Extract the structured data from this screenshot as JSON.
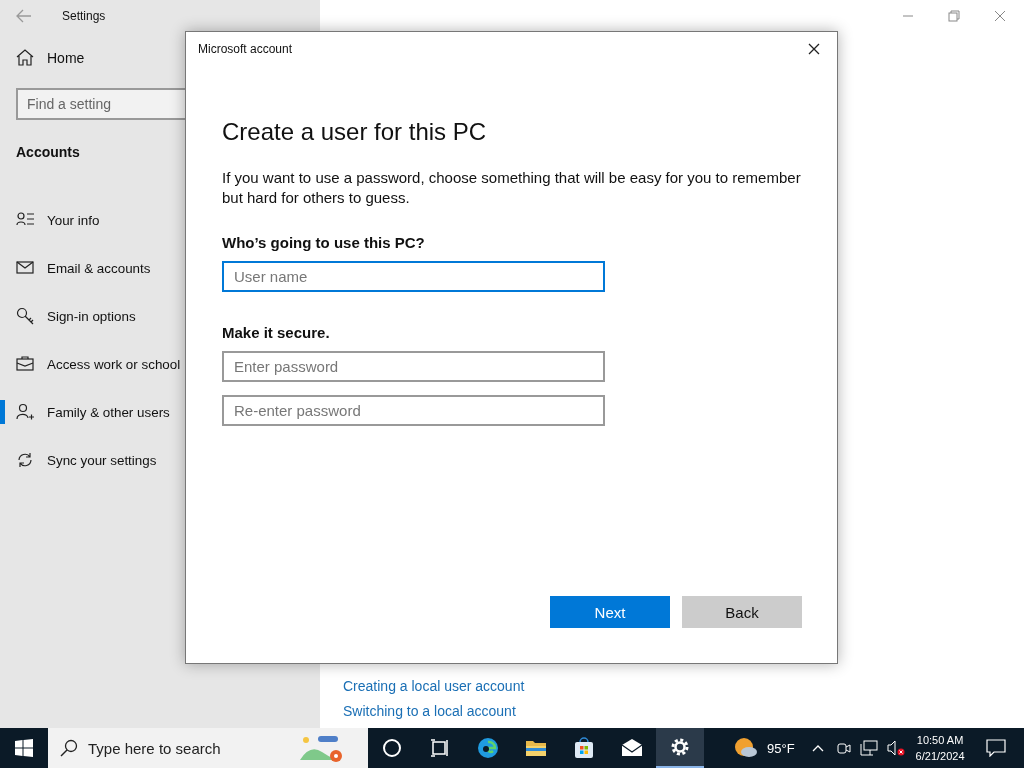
{
  "window": {
    "title": "Settings"
  },
  "sidebar": {
    "home": "Home",
    "search": {
      "placeholder": "Find a setting"
    },
    "section": "Accounts",
    "items": [
      {
        "label": "Your info",
        "kind": "info",
        "selected": false
      },
      {
        "label": "Email & accounts",
        "kind": "mail",
        "selected": false
      },
      {
        "label": "Sign-in options",
        "kind": "key",
        "selected": false
      },
      {
        "label": "Access work or school",
        "kind": "work",
        "selected": false
      },
      {
        "label": "Family & other users",
        "kind": "family",
        "selected": true
      },
      {
        "label": "Sync your settings",
        "kind": "sync",
        "selected": false
      }
    ]
  },
  "main": {
    "links": [
      "Creating a local user account",
      "Switching to a local account"
    ]
  },
  "dialog": {
    "title": "Microsoft account",
    "heading": "Create a user for this PC",
    "description": "If you want to use a password, choose something that will be easy for you to remember but hard for others to guess.",
    "sections": [
      {
        "label": "Who’s going to use this PC?",
        "fields": [
          {
            "placeholder": "User name",
            "focused": true
          }
        ]
      },
      {
        "label": "Make it secure.",
        "fields": [
          {
            "placeholder": "Enter password",
            "focused": false
          },
          {
            "placeholder": "Re-enter password",
            "focused": false
          }
        ]
      }
    ],
    "buttons": [
      {
        "label": "Next",
        "kind": "primary"
      },
      {
        "label": "Back",
        "kind": "secondary"
      }
    ]
  },
  "taskbar": {
    "search": {
      "placeholder": "Type here to search"
    },
    "apps": [
      {
        "kind": "cortana",
        "selected": false
      },
      {
        "kind": "taskview",
        "selected": false
      },
      {
        "kind": "edge",
        "selected": false
      },
      {
        "kind": "explorer",
        "selected": false
      },
      {
        "kind": "store",
        "selected": false
      },
      {
        "kind": "mail",
        "selected": false
      },
      {
        "kind": "settings",
        "selected": true
      }
    ],
    "weather": "95°F",
    "time": "10:50 AM",
    "date": "6/21/2024"
  }
}
